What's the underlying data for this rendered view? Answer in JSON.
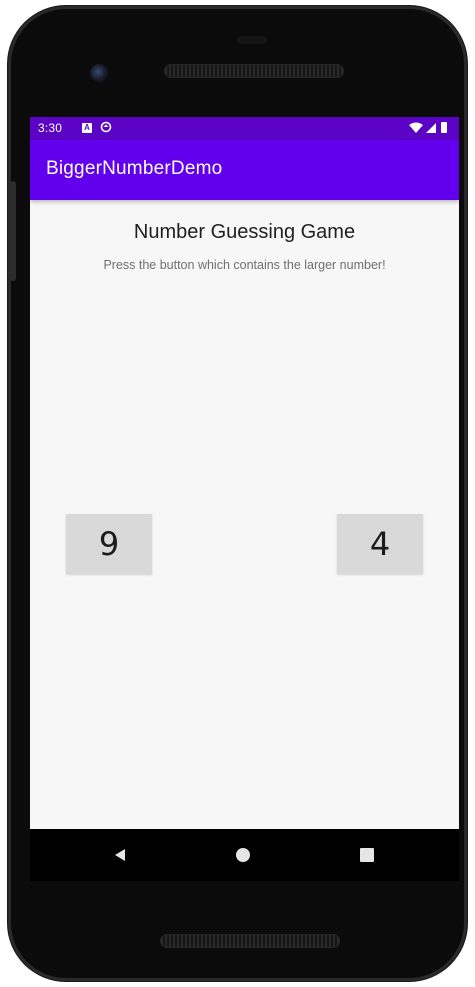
{
  "status_bar": {
    "time": "3:30",
    "notification_a_label": "A"
  },
  "app_bar": {
    "title": "BiggerNumberDemo"
  },
  "main": {
    "headline": "Number Guessing Game",
    "subtitle": "Press the button which contains the larger number!",
    "left_button_value": "9",
    "right_button_value": "4"
  },
  "colors": {
    "status_bar": "#5b04c6",
    "app_bar": "#6200ee",
    "screen_bg": "#f7f7f7",
    "button_bg": "#d8d9d8"
  },
  "icons": {
    "status": [
      "notification-a-icon",
      "sync-icon",
      "wifi-icon",
      "signal-icon",
      "battery-icon"
    ],
    "nav": [
      "back-icon",
      "home-icon",
      "recents-icon"
    ]
  }
}
